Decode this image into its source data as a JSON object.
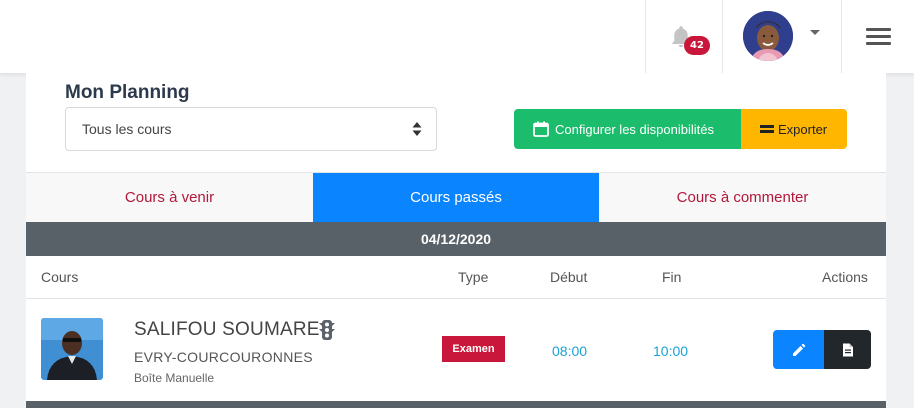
{
  "topbar": {
    "notifications_count": "42",
    "icons": [
      "bell-icon",
      "chevron-down-icon",
      "menu-icon"
    ]
  },
  "page": {
    "title": "Mon Planning",
    "filter_select": {
      "value": "Tous les cours"
    },
    "buttons": {
      "configure": "Configurer les disponibilités",
      "export": "Exporter"
    }
  },
  "tabs": [
    {
      "label": "Cours à venir",
      "active": false
    },
    {
      "label": "Cours passés",
      "active": true
    },
    {
      "label": "Cours à commenter",
      "active": false
    }
  ],
  "group_date": "04/12/2020",
  "table": {
    "columns": [
      "Cours",
      "Type",
      "Début",
      "Fin",
      "Actions"
    ],
    "rows": [
      {
        "student_name": "SALIFOU SOUMARE",
        "city": "EVRY-COURCOURONNES",
        "gearbox": "Boîte Manuelle",
        "type": "Examen",
        "start": "08:00",
        "end": "10:00"
      }
    ]
  },
  "colors": {
    "primary": "#0b84ff",
    "success": "#1bbd6c",
    "warning": "#ffb600",
    "danger": "#c8173a",
    "dark_bar": "#596168",
    "time_text": "#1ba1d6"
  }
}
